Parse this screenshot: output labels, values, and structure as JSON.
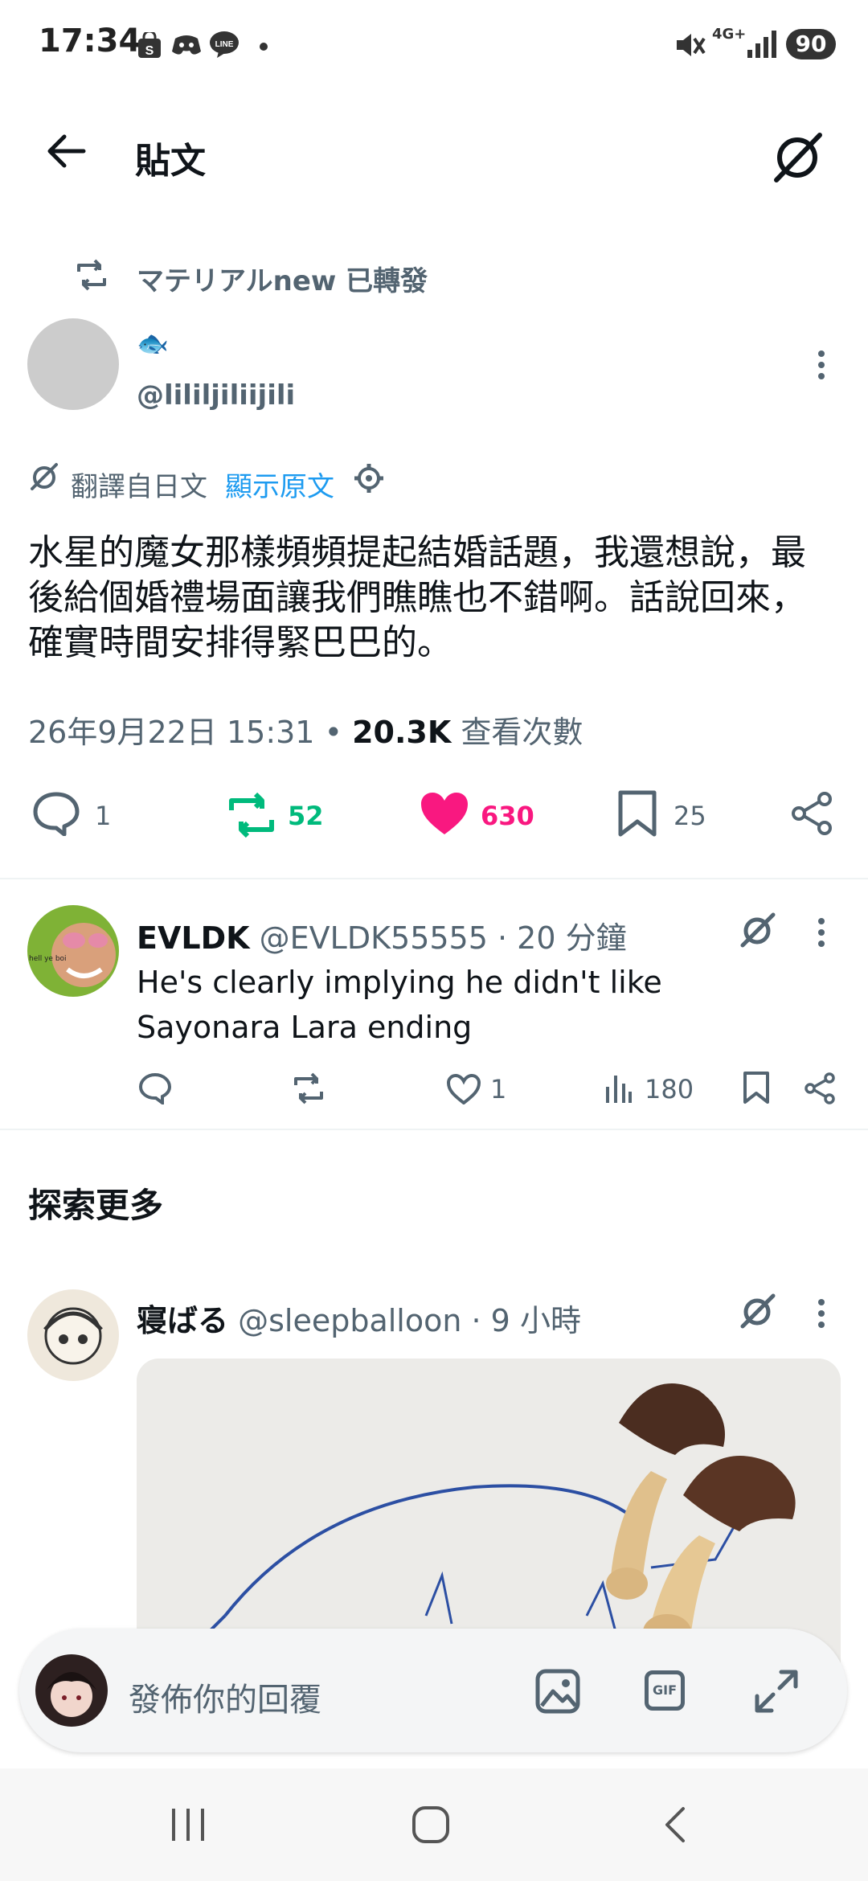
{
  "status_bar": {
    "time": "17:34",
    "network": "4G+",
    "battery": "90"
  },
  "header": {
    "title": "貼文"
  },
  "retweet": {
    "label": "マテリアルnew 已轉發"
  },
  "author": {
    "display_name": "🐟",
    "handle": "@lililjiliijili"
  },
  "translation": {
    "label": "翻譯自日文",
    "show_original": "顯示原文"
  },
  "post": {
    "text": "水星的魔女那樣頻頻提起結婚話題，我還想說，最後給個婚禮場面讓我們瞧瞧也不錯啊。話說回來，確實時間安排得緊巴巴的。",
    "date": "26年9月22日 15:31",
    "separator": "•",
    "views_count": "20.3K",
    "views_label": "查看次數",
    "stats": {
      "replies": "1",
      "reposts": "52",
      "likes": "630",
      "bookmarks": "25"
    }
  },
  "reply": {
    "display_name": "EVLDK",
    "handle_time": "@EVLDK55555 · 20 分鐘",
    "avatar_text": "hell ye boi",
    "text": "He's clearly implying  he didn't like Sayonara Lara ending",
    "likes": "1",
    "views": "180"
  },
  "explore": {
    "heading": "探索更多"
  },
  "explore_post": {
    "display_name": "寝ばる",
    "handle_time": "@sleepballoon · 9 小時"
  },
  "composer": {
    "placeholder": "發佈你的回覆",
    "gif_label": "GIF"
  },
  "colors": {
    "link_blue": "#1d9bf0",
    "repost_green": "#00ba7c",
    "like_pink": "#f91880",
    "text_muted": "#536471"
  }
}
